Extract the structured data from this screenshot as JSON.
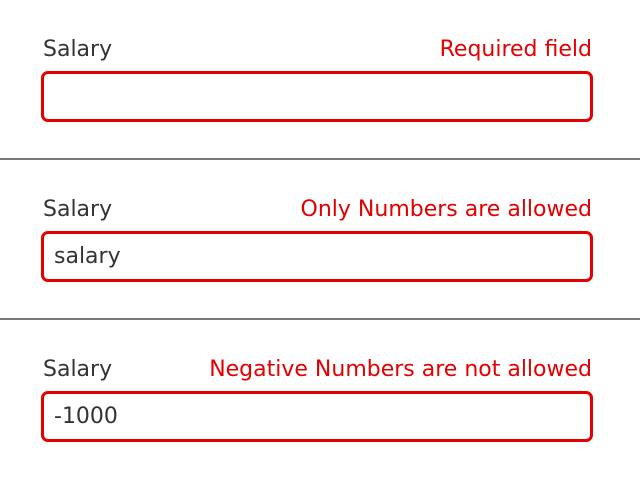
{
  "colors": {
    "error": "#e30000",
    "text": "#333333",
    "divider": "#7a7a7a"
  },
  "fields": [
    {
      "label": "Salary",
      "error": "Required field",
      "value": ""
    },
    {
      "label": "Salary",
      "error": "Only Numbers are allowed",
      "value": "salary"
    },
    {
      "label": "Salary",
      "error": "Negative Numbers are not allowed",
      "value": "-1000"
    }
  ]
}
